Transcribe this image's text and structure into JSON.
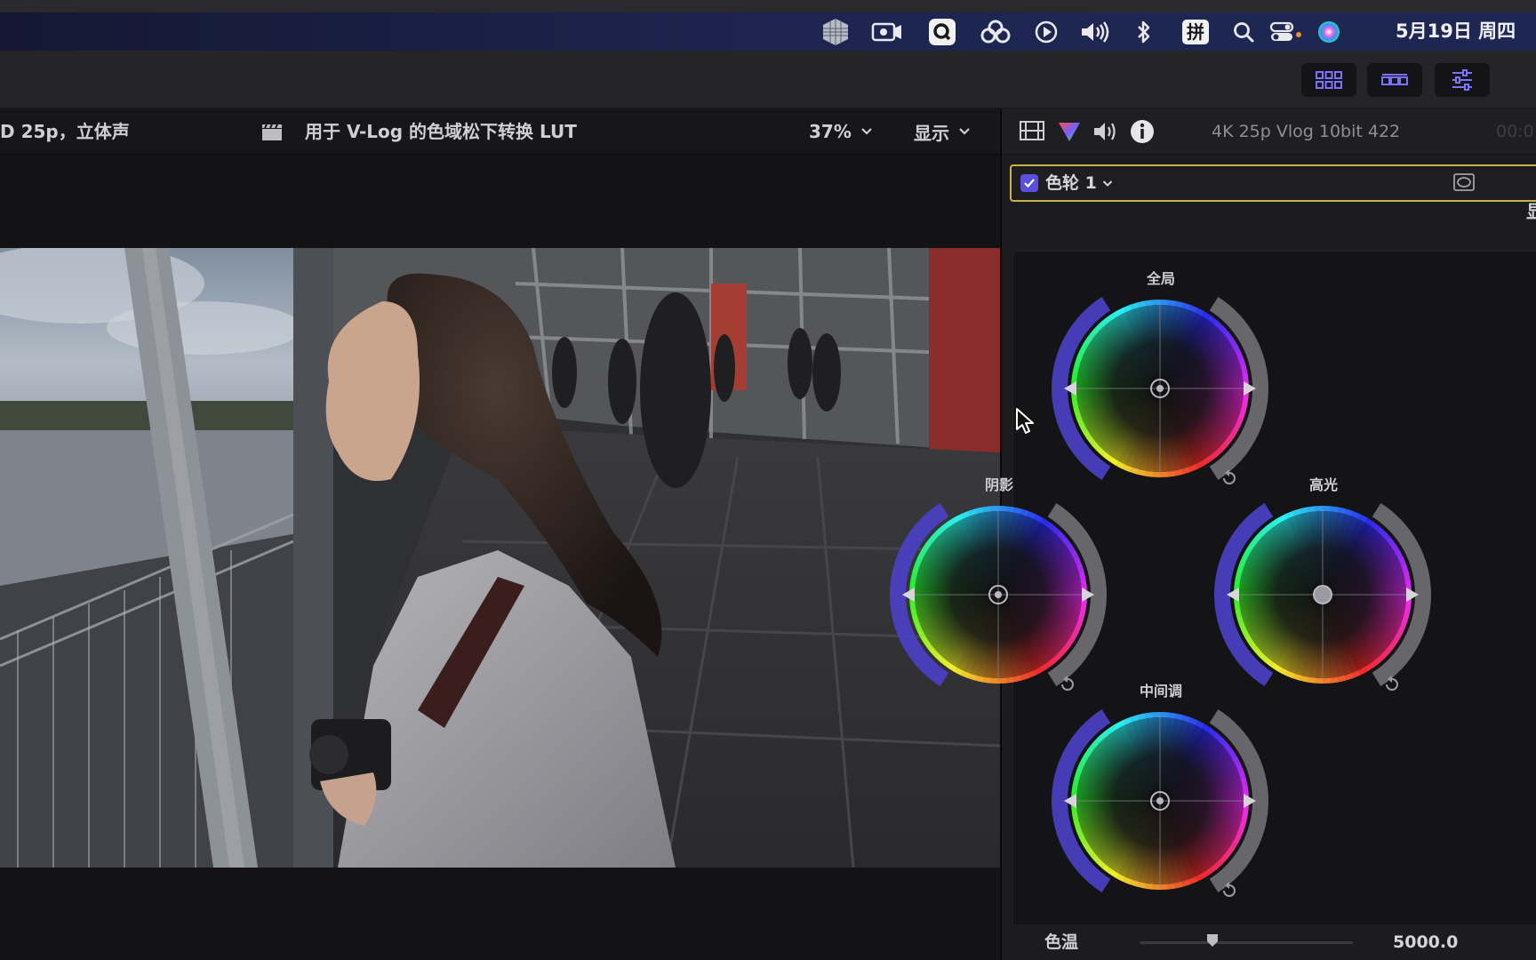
{
  "menubar": {
    "date": "5月19日 周四",
    "icons": [
      "stack-icon",
      "screen-record-icon",
      "q-app-icon",
      "creative-cloud-icon",
      "play-circle-icon",
      "volume-icon",
      "bluetooth-icon",
      "input-method-icon",
      "search-icon",
      "control-center-icon",
      "siri-icon"
    ],
    "input_method_glyph": "拼"
  },
  "toolbar": {
    "buttons": [
      "grid-view-icon",
      "filmstrip-view-icon",
      "inspector-toggle-icon"
    ]
  },
  "viewer": {
    "format_text": "D 25p，立体声",
    "lut_label": "用于 V-Log 的色域松下转换 LUT",
    "zoom": "37%",
    "display_menu": "显示"
  },
  "inspector": {
    "format": "4K 25p Vlog 10bit 422",
    "timecode": "00:0",
    "effect_name": "色轮 1",
    "effect_enabled": true,
    "right_edge_char": "显",
    "wheels": {
      "global": "全局",
      "shadows": "阴影",
      "highlights": "高光",
      "midtones": "中间调"
    },
    "temperature": {
      "label": "色温",
      "value": "5000.0",
      "slider_fraction": 0.34
    }
  },
  "colors": {
    "menubar": "#1d2550",
    "accent_selected": "#c9b24a",
    "checkbox": "#5b4fe0"
  }
}
